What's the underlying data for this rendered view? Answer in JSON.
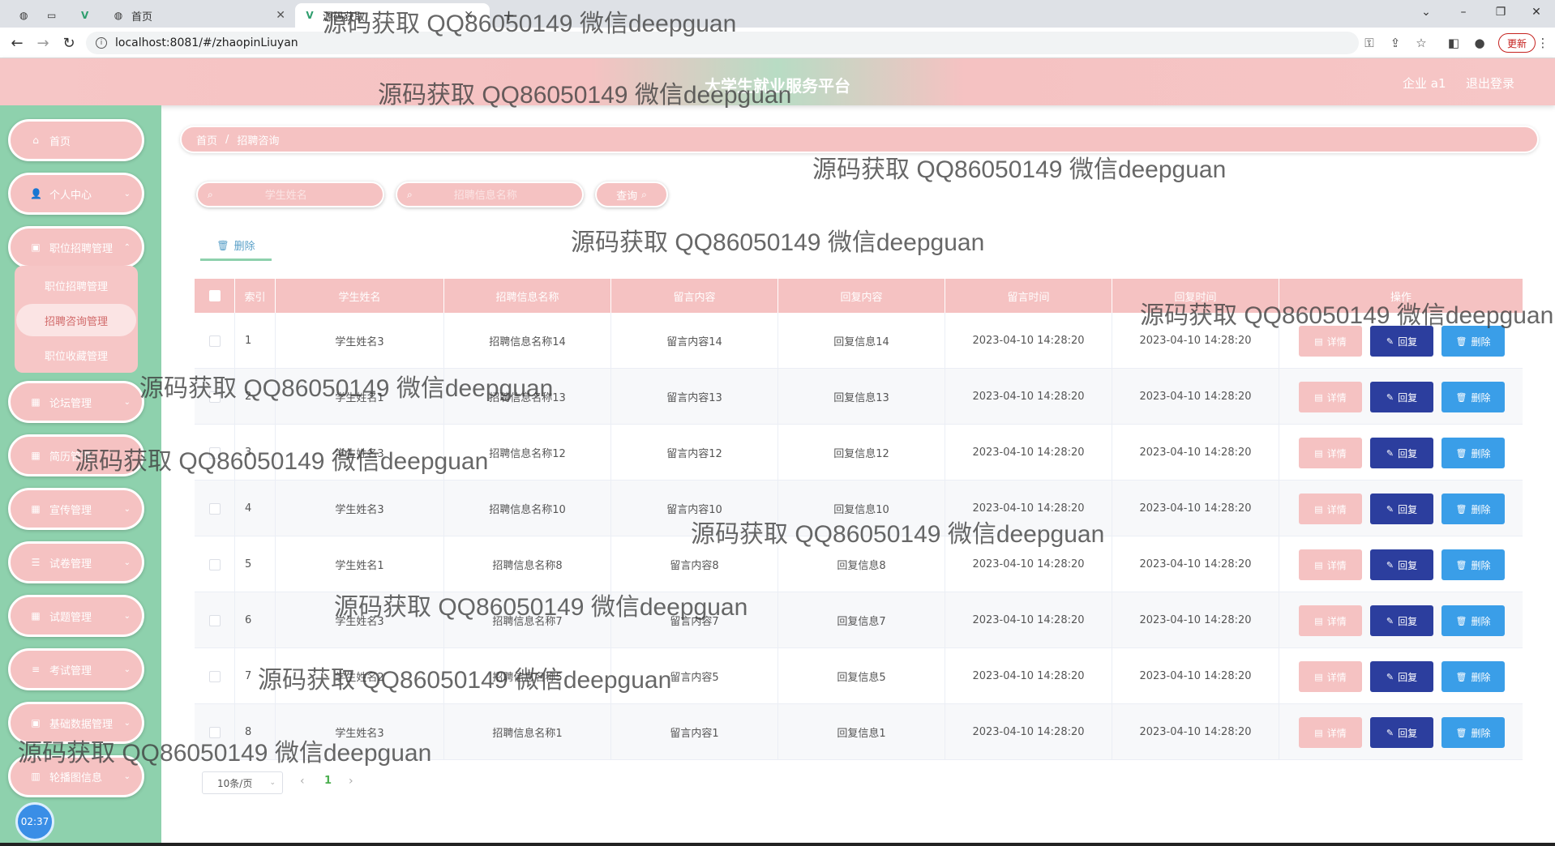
{
  "browser": {
    "tabs": [
      {
        "label": ""
      },
      {
        "label": ""
      },
      {
        "label": ""
      },
      {
        "label": "首页"
      },
      {
        "label": "源码获取"
      }
    ],
    "url": "localhost:8081/#/zhaopinLiuyan",
    "update_label": "更新"
  },
  "header": {
    "title": "大学生就业服务平台",
    "user": "企业 a1",
    "logout": "退出登录"
  },
  "sidebar": {
    "items": [
      {
        "label": "首页"
      },
      {
        "label": "个人中心"
      },
      {
        "label": "职位招聘管理"
      },
      {
        "label": "论坛管理"
      },
      {
        "label": "简历管理"
      },
      {
        "label": "宣传管理"
      },
      {
        "label": "试卷管理"
      },
      {
        "label": "试题管理"
      },
      {
        "label": "考试管理"
      },
      {
        "label": "基础数据管理"
      },
      {
        "label": "轮播图信息"
      }
    ],
    "submenu": [
      {
        "label": "职位招聘管理"
      },
      {
        "label": "招聘咨询管理"
      },
      {
        "label": "职位收藏管理"
      }
    ],
    "clock": "02:37"
  },
  "breadcrumb": {
    "home": "首页",
    "sep": "/",
    "current": "招聘咨询"
  },
  "search": {
    "student_placeholder": "学生姓名",
    "job_placeholder": "招聘信息名称",
    "query_label": "查询"
  },
  "toolbar": {
    "delete_label": "删除"
  },
  "table": {
    "headers": [
      "索引",
      "学生姓名",
      "招聘信息名称",
      "留言内容",
      "回复内容",
      "留言时间",
      "回复时间",
      "操作"
    ],
    "rows": [
      {
        "idx": "1",
        "student": "学生姓名3",
        "job": "招聘信息名称14",
        "msg": "留言内容14",
        "reply": "回复信息14",
        "msg_time": "2023-04-10 14:28:20",
        "reply_time": "2023-04-10 14:28:20"
      },
      {
        "idx": "2",
        "student": "学生姓名1",
        "job": "招聘信息名称13",
        "msg": "留言内容13",
        "reply": "回复信息13",
        "msg_time": "2023-04-10 14:28:20",
        "reply_time": "2023-04-10 14:28:20"
      },
      {
        "idx": "3",
        "student": "学生姓名3",
        "job": "招聘信息名称12",
        "msg": "留言内容12",
        "reply": "回复信息12",
        "msg_time": "2023-04-10 14:28:20",
        "reply_time": "2023-04-10 14:28:20"
      },
      {
        "idx": "4",
        "student": "学生姓名3",
        "job": "招聘信息名称10",
        "msg": "留言内容10",
        "reply": "回复信息10",
        "msg_time": "2023-04-10 14:28:20",
        "reply_time": "2023-04-10 14:28:20"
      },
      {
        "idx": "5",
        "student": "学生姓名1",
        "job": "招聘信息名称8",
        "msg": "留言内容8",
        "reply": "回复信息8",
        "msg_time": "2023-04-10 14:28:20",
        "reply_time": "2023-04-10 14:28:20"
      },
      {
        "idx": "6",
        "student": "学生姓名3",
        "job": "招聘信息名称7",
        "msg": "留言内容7",
        "reply": "回复信息7",
        "msg_time": "2023-04-10 14:28:20",
        "reply_time": "2023-04-10 14:28:20"
      },
      {
        "idx": "7",
        "student": "学生姓名2",
        "job": "招聘信息名称5",
        "msg": "留言内容5",
        "reply": "回复信息5",
        "msg_time": "2023-04-10 14:28:20",
        "reply_time": "2023-04-10 14:28:20"
      },
      {
        "idx": "8",
        "student": "学生姓名3",
        "job": "招聘信息名称1",
        "msg": "留言内容1",
        "reply": "回复信息1",
        "msg_time": "2023-04-10 14:28:20",
        "reply_time": "2023-04-10 14:28:20"
      }
    ],
    "actions": {
      "detail": "详情",
      "reply": "回复",
      "delete": "删除"
    }
  },
  "pagination": {
    "page_size": "10条/页",
    "current_page": "1"
  },
  "watermark": "源码获取 QQ86050149 微信deepguan",
  "colors": {
    "pink": "#f5c2c2",
    "green": "#8ed1ad",
    "reply_button": "#2c3e9e",
    "delete_button": "#3a9ee8"
  }
}
